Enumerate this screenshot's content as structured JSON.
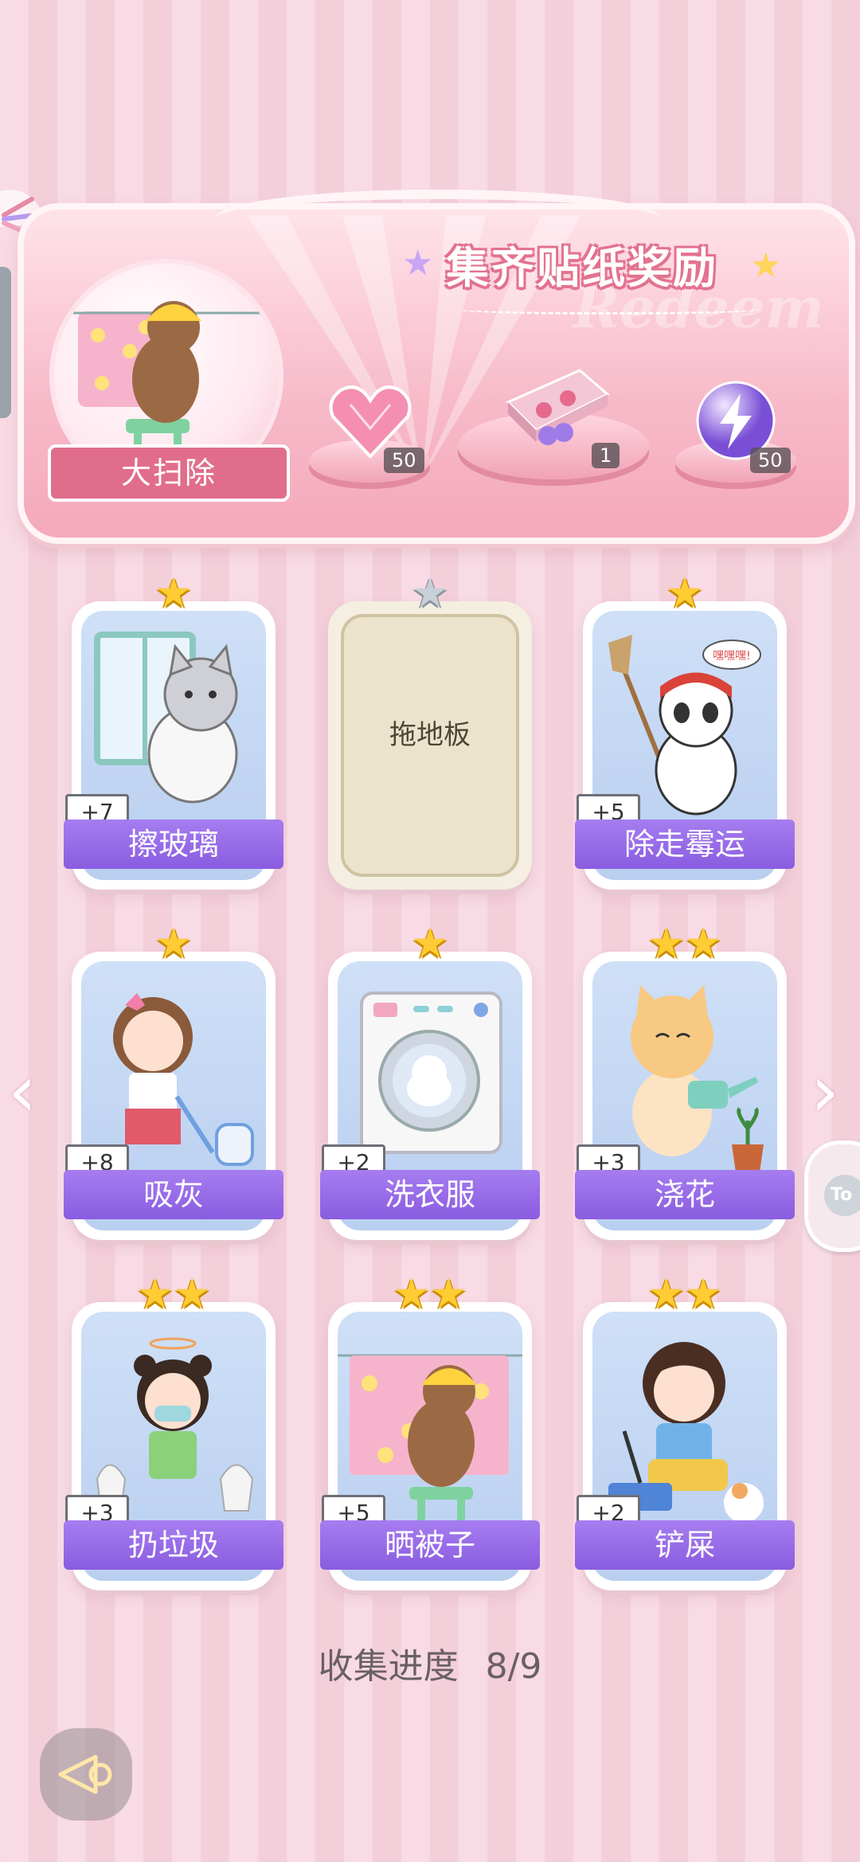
{
  "banner": {
    "title": "集齐贴纸奖励",
    "watermark": "Redeem",
    "feature_label": "大扫除",
    "rewards": [
      {
        "icon": "pink-heart-gem-icon",
        "count": "50"
      },
      {
        "icon": "gift-box-icon",
        "count": "1"
      },
      {
        "icon": "lightning-orb-icon",
        "count": "50"
      }
    ]
  },
  "cards": [
    {
      "label": "擦玻璃",
      "points": "+7",
      "stars": 1,
      "collected": true
    },
    {
      "label": "拖地板",
      "points": "",
      "stars": 1,
      "collected": false
    },
    {
      "label": "除走霉运",
      "points": "+5",
      "stars": 1,
      "collected": true
    },
    {
      "label": "吸灰",
      "points": "+8",
      "stars": 1,
      "collected": true
    },
    {
      "label": "洗衣服",
      "points": "+2",
      "stars": 1,
      "collected": true
    },
    {
      "label": "浇花",
      "points": "+3",
      "stars": 2,
      "collected": true
    },
    {
      "label": "扔垃圾",
      "points": "+3",
      "stars": 2,
      "collected": true
    },
    {
      "label": "晒被子",
      "points": "+5",
      "stars": 2,
      "collected": true
    },
    {
      "label": "铲屎",
      "points": "+2",
      "stars": 2,
      "collected": true
    }
  ],
  "panda_speech": "嘿嘿嘿!",
  "progress": {
    "label": "收集进度",
    "value": "8/9"
  },
  "side_button_text": "To"
}
